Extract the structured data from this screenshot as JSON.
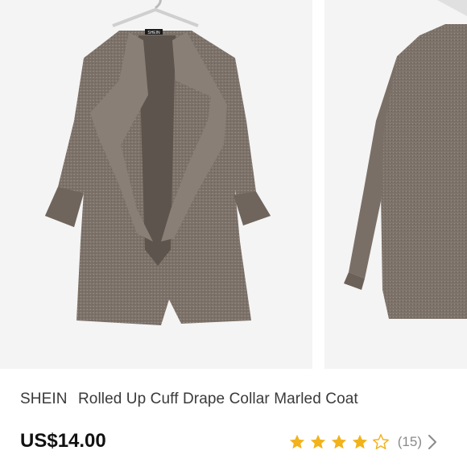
{
  "product": {
    "brand": "SHEIN",
    "name": "Rolled Up Cuff Drape Collar Marled Coat",
    "price": "US$14.00",
    "review_count": "(15)",
    "rating_stars_filled": 4,
    "rating_stars_total": 5,
    "label_tag_text": "SHEIN"
  },
  "gallery": {
    "images": [
      {
        "icon": "coat-front-image"
      },
      {
        "icon": "coat-back-image"
      }
    ]
  },
  "colors": {
    "star": "#f2b21b",
    "coat": "#7d7269",
    "background": "#f4f4f4",
    "price": "#111111",
    "muted": "#8a8a8a"
  }
}
